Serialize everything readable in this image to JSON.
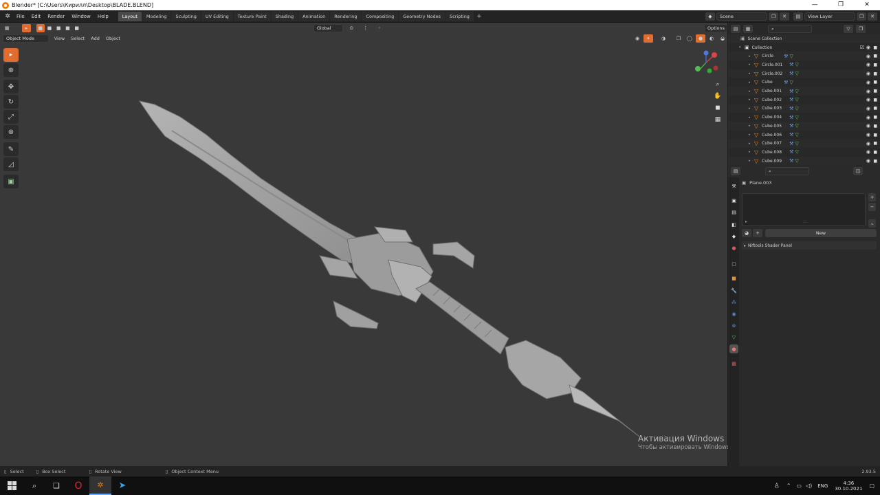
{
  "window": {
    "title": "Blender* [C:\\Users\\Кирилл\\Desktop\\BLADE.BLEND]",
    "min": "—",
    "max": "❐",
    "close": "✕"
  },
  "menu": [
    "File",
    "Edit",
    "Render",
    "Window",
    "Help"
  ],
  "workspaces": [
    "Layout",
    "Modeling",
    "Sculpting",
    "UV Editing",
    "Texture Paint",
    "Shading",
    "Animation",
    "Rendering",
    "Compositing",
    "Geometry Nodes",
    "Scripting"
  ],
  "active_workspace": "Layout",
  "scene": {
    "label": "Scene",
    "view_layer": "View Layer"
  },
  "viewport": {
    "transform_orientation": "Global",
    "mode": "Object Mode",
    "menus": [
      "View",
      "Select",
      "Add",
      "Object"
    ],
    "options_label": "Options",
    "gizmo_axes": {
      "x": "X",
      "y": "Y",
      "z": "Z"
    }
  },
  "outliner": {
    "root": "Scene Collection",
    "collection": "Collection",
    "items": [
      "Circle",
      "Circle.001",
      "Circle.002",
      "Cube",
      "Cube.001",
      "Cube.002",
      "Cube.003",
      "Cube.004",
      "Cube.005",
      "Cube.006",
      "Cube.007",
      "Cube.008",
      "Cube.009"
    ]
  },
  "properties": {
    "object_name": "Plane.003",
    "new_button": "New",
    "panel_title": "Niftools Shader Panel"
  },
  "statusbar": {
    "select": "Select",
    "box_select": "Box Select",
    "rotate_view": "Rotate View",
    "context_menu": "Object Context Menu",
    "version": "2.93.5"
  },
  "watermark": {
    "title": "Активация Windows",
    "subtitle": "Чтобы активировать Windows, перейдите в раздел \"Параметры\"."
  },
  "taskbar": {
    "lang": "ENG",
    "time": "4:36",
    "date": "30.10.2021"
  },
  "colors": {
    "accent": "#e06c2f",
    "viewport_bg": "#393939",
    "mesh": "#a9a9a9"
  }
}
